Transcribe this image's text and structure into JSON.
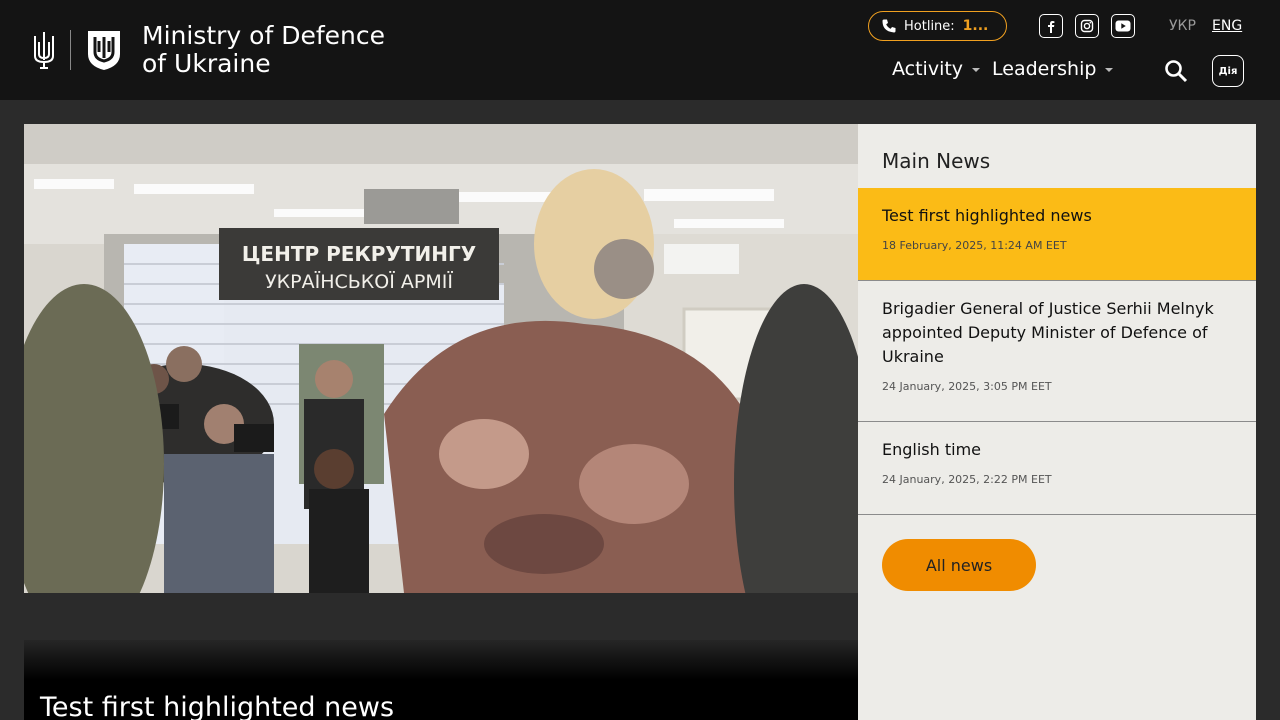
{
  "header": {
    "site_title_line1": "Ministry of Defence",
    "site_title_line2": "of Ukraine",
    "hotline_label": "Hotline:",
    "hotline_number": "1...",
    "languages": {
      "ukr": "УКР",
      "eng": "ENG"
    },
    "nav": [
      {
        "label": "Activity"
      },
      {
        "label": "Leadership"
      }
    ],
    "social_icons": [
      "facebook-icon",
      "instagram-icon",
      "youtube-icon"
    ],
    "diia_label": "Дія"
  },
  "hero": {
    "banner_line1": "ЦЕНТР РЕКРУТИНГУ",
    "banner_line2": "УКРАЇНСЬКОЇ АРМІЇ",
    "title": "Test first highlighted news"
  },
  "main_news": {
    "heading": "Main News",
    "items": [
      {
        "title": "Test first highlighted news",
        "date": "18 February, 2025, 11:24 AM EET",
        "highlighted": true
      },
      {
        "title": "Brigadier General of Justice Serhii Melnyk appointed Deputy Minister of Defence of Ukraine",
        "date": "24 January, 2025, 3:05 PM EET",
        "highlighted": false
      },
      {
        "title": "English time",
        "date": "24 January, 2025, 2:22 PM EET",
        "highlighted": false
      }
    ],
    "all_news_label": "All news"
  },
  "colors": {
    "header_bg": "#141414",
    "accent_orange": "#f08c00",
    "highlight_yellow": "#fbbb16",
    "panel_bg": "#edece8"
  }
}
